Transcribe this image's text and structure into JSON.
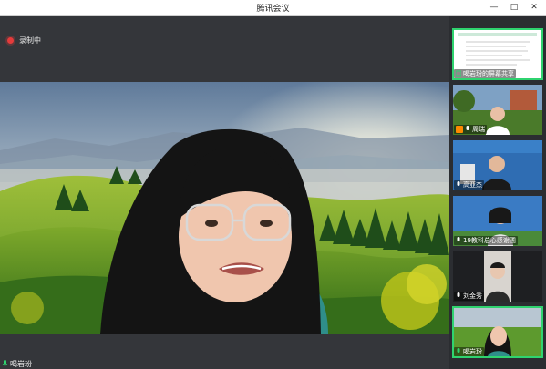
{
  "window": {
    "title": "腾讯会议",
    "controls": {
      "minimize": "—",
      "maximize": "□",
      "close": "✕"
    }
  },
  "recording": {
    "label": "录制中"
  },
  "main_speaker": {
    "name": "喝岩玢"
  },
  "participants": [
    {
      "name": "喝岩玢的屏幕共享"
    },
    {
      "name": "周瑞"
    },
    {
      "name": "高亚杰"
    },
    {
      "name": "19教科总心感谢圃"
    },
    {
      "name": "刘金秀"
    },
    {
      "name": "喝岩玢"
    }
  ],
  "colors": {
    "active_outline": "#2fd36f",
    "record_dot": "#e43b3b",
    "mic_green": "#2fd36f"
  }
}
